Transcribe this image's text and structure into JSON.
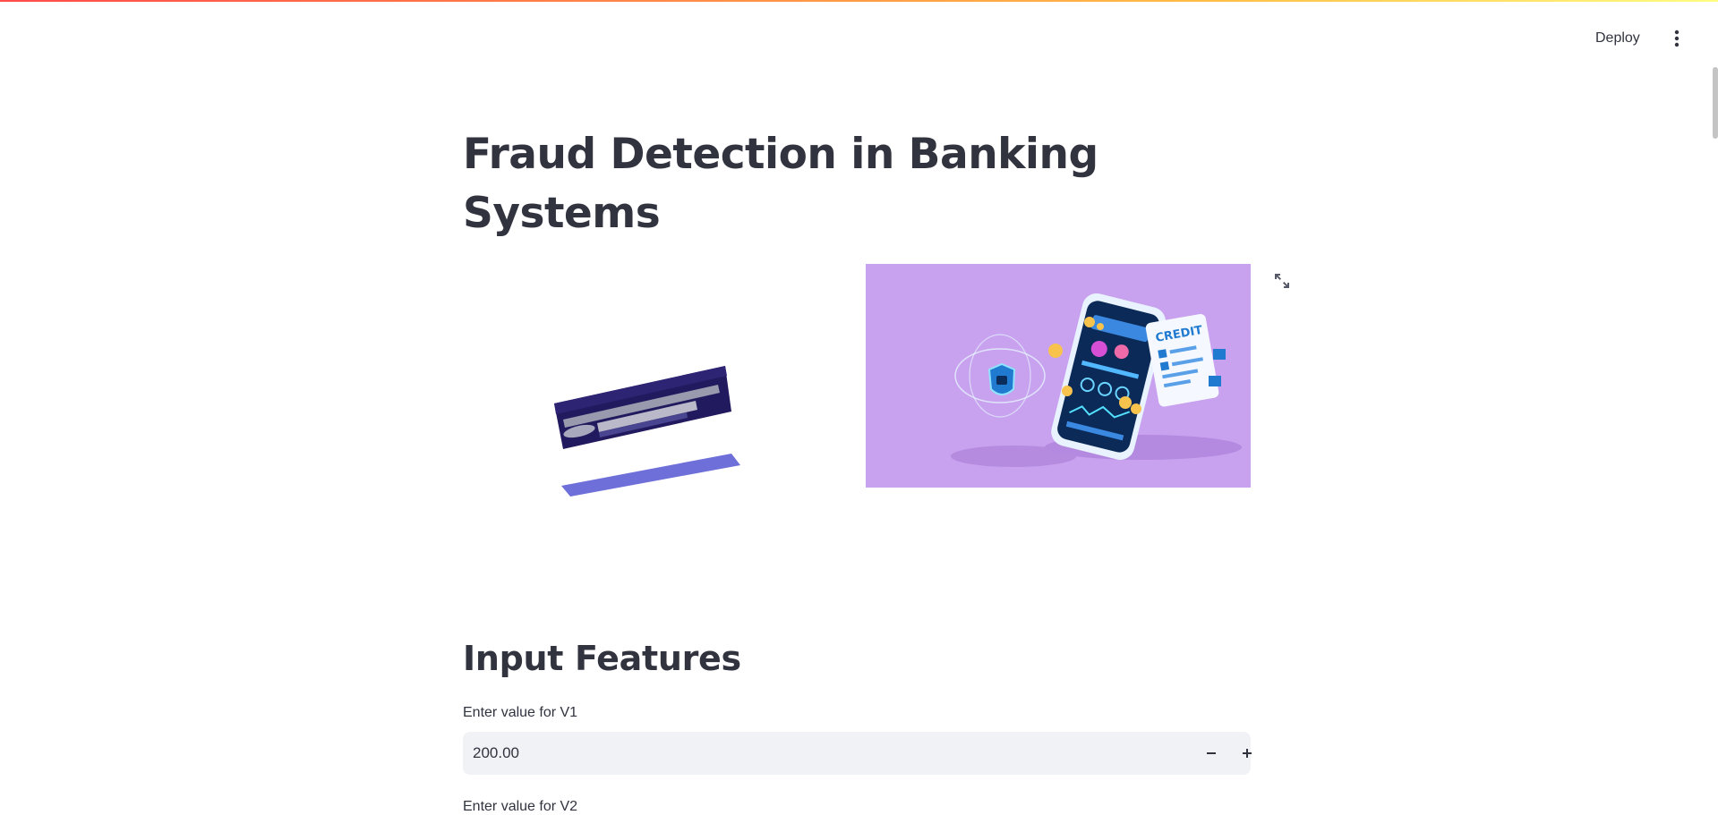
{
  "header": {
    "deploy_label": "Deploy",
    "menu_icon": "kebab-menu-icon"
  },
  "main": {
    "title": "Fraud Detection in Banking Systems",
    "images": {
      "fintech_image_text": "CREDIT",
      "fullscreen_icon": "fullscreen-expand-icon"
    },
    "section_heading": "Input Features",
    "inputs": [
      {
        "label": "Enter value for V1",
        "value": "200.00"
      },
      {
        "label": "Enter value for V2"
      }
    ]
  },
  "colors": {
    "text": "#31333f",
    "input_background": "#f0f2f6",
    "image_background": "#c9a2ef",
    "card_dark": "#221a5e",
    "card_shadow": "#6e6fd9"
  }
}
